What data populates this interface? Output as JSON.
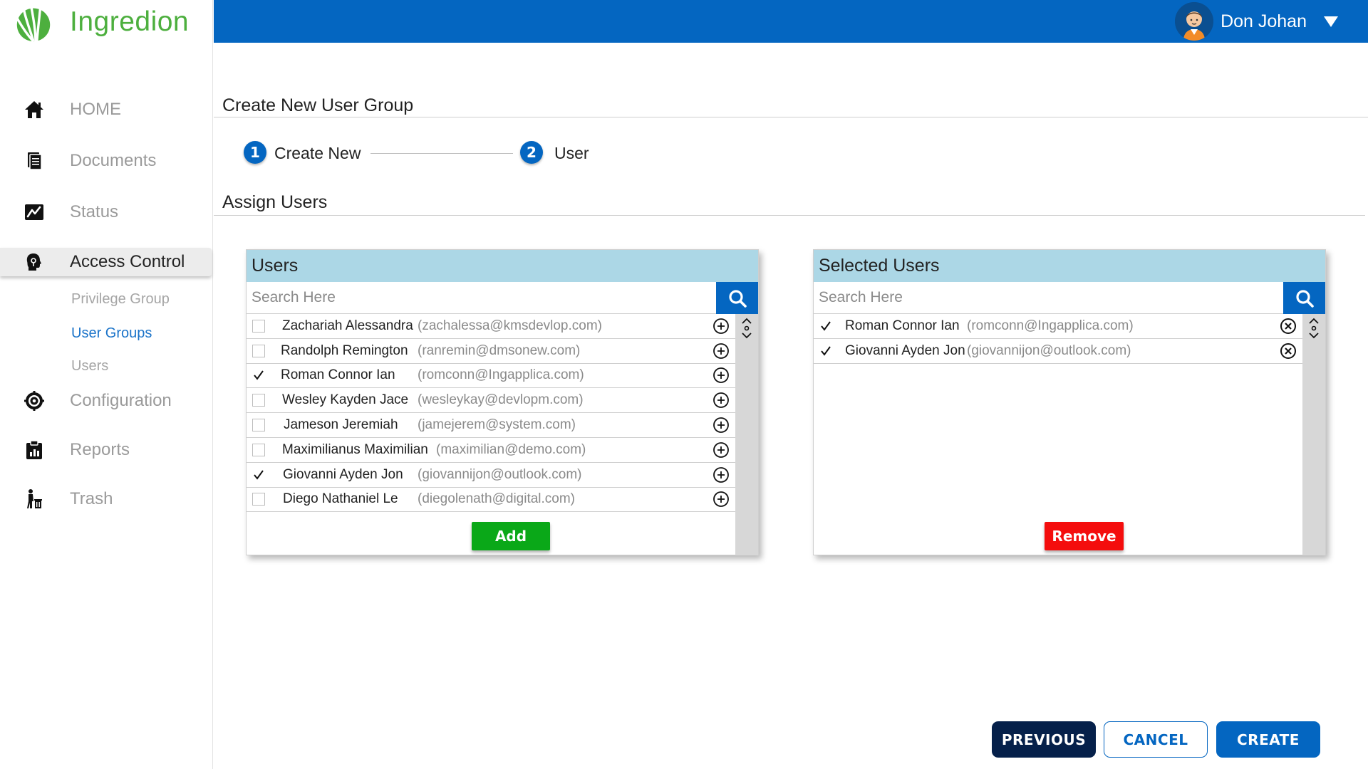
{
  "app": {
    "brand_name": "Ingredion",
    "brand_color": "#4daf3e",
    "header_color": "#0466c1"
  },
  "user": {
    "name": "Don Johan"
  },
  "sidebar": {
    "items": [
      {
        "label": "HOME",
        "icon": "home-icon"
      },
      {
        "label": "Documents",
        "icon": "documents-icon"
      },
      {
        "label": "Status",
        "icon": "status-chart-icon"
      },
      {
        "label": "Access Control",
        "icon": "access-control-icon",
        "active": true
      },
      {
        "label": "Configuration",
        "icon": "configuration-gear-icon"
      },
      {
        "label": "Reports",
        "icon": "reports-clipboard-icon"
      },
      {
        "label": "Trash",
        "icon": "trash-person-icon"
      }
    ],
    "sub_items": [
      {
        "label": "Privilege Group"
      },
      {
        "label": "User Groups",
        "active": true
      },
      {
        "label": "Users"
      }
    ]
  },
  "page": {
    "title": "Create New User Group",
    "steps": [
      {
        "number": "1",
        "label": "Create New"
      },
      {
        "number": "2",
        "label": "User"
      }
    ],
    "section_title": "Assign Users"
  },
  "users_panel": {
    "title": "Users",
    "search_placeholder": "Search Here",
    "rows": [
      {
        "name": "Zachariah Alessandra",
        "email": "(zachalessa@kmsdevlop.com)",
        "checked": false
      },
      {
        "name": "Randolph Remington",
        "email": "(ranremin@dmsonew.com)",
        "checked": false
      },
      {
        "name": "Roman Connor Ian",
        "email": "(romconn@Ingapplica.com)",
        "checked": true
      },
      {
        "name": "Wesley Kayden Jace",
        "email": "(wesleykay@devlopm.com)",
        "checked": false
      },
      {
        "name": "Jameson Jeremiah",
        "email": "(jamejerem@system.com)",
        "checked": false
      },
      {
        "name": "Maximilianus Maximilian",
        "email": "(maximilian@demo.com)",
        "checked": false
      },
      {
        "name": "Giovanni Ayden Jon",
        "email": "(giovannijon@outlook.com)",
        "checked": true
      },
      {
        "name": "Diego Nathaniel Le",
        "email": "(diegolenath@digital.com)",
        "checked": false
      }
    ],
    "add_label": "Add",
    "add_color": "#0aa818"
  },
  "selected_panel": {
    "title": "Selected Users",
    "search_placeholder": "Search Here",
    "rows": [
      {
        "name": "Roman Connor Ian",
        "email": "(romconn@Ingapplica.com)",
        "checked": true
      },
      {
        "name": "Giovanni Ayden Jon",
        "email": "(giovannijon@outlook.com)",
        "checked": true
      }
    ],
    "remove_label": "Remove",
    "remove_color": "#f40d0d"
  },
  "footer": {
    "previous_label": "PREVIOUS",
    "cancel_label": "CANCEL",
    "create_label": "CREATE"
  }
}
